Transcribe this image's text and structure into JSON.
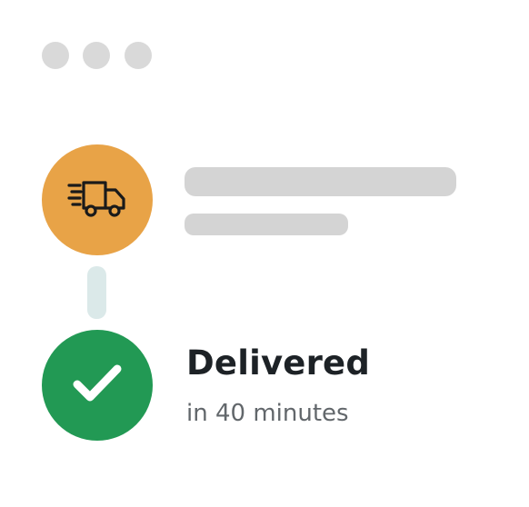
{
  "window": {
    "dots": [
      "dot",
      "dot",
      "dot"
    ]
  },
  "steps": [
    {
      "state": "in-transit",
      "icon": "delivery-truck-icon",
      "color": "#e8a347"
    },
    {
      "state": "delivered",
      "icon": "checkmark-icon",
      "color": "#229954",
      "title": "Delivered",
      "subtitle": "in 40 minutes"
    }
  ],
  "colors": {
    "placeholder": "#d4d4d4",
    "connector": "#dbe9e9",
    "window_dot": "#d9d9d9",
    "title_text": "#1d2226",
    "subtitle_text": "#62676b"
  }
}
